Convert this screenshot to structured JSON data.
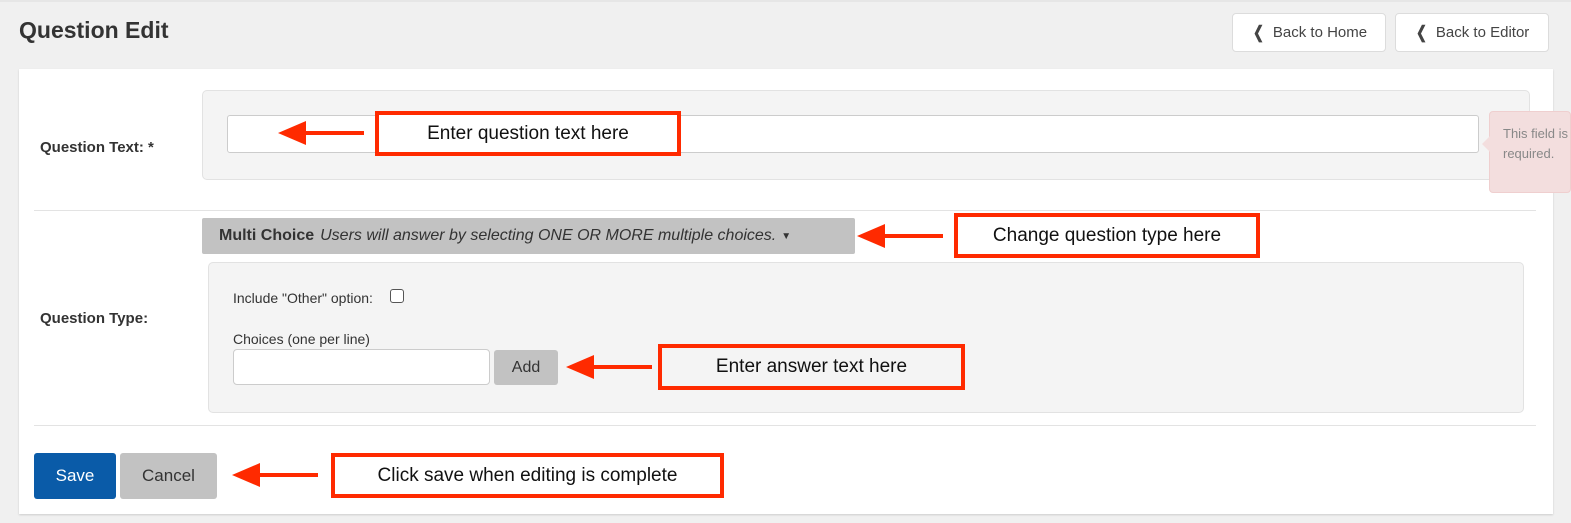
{
  "header": {
    "title": "Question Edit",
    "back_home_label": "Back to Home",
    "back_editor_label": "Back to Editor",
    "chevron_glyph": "❮"
  },
  "form": {
    "question_text_label": "Question Text: *",
    "question_text_value": "",
    "validation_message": "This field is required.",
    "question_type_label": "Question Type:",
    "question_type": {
      "selected_name": "Multi Choice",
      "selected_description": "Users will answer by selecting ONE OR MORE multiple choices.",
      "caret_glyph": "▼"
    },
    "include_other_label": "Include \"Other\" option:",
    "include_other_checked": false,
    "choices_label": "Choices (one per line)",
    "choices_value": "",
    "add_label": "Add",
    "save_label": "Save",
    "cancel_label": "Cancel"
  },
  "annotations": {
    "question_text": "Enter question text here",
    "question_type": "Change question type here",
    "answer_text": "Enter answer text here",
    "save": "Click save when editing is complete"
  },
  "colors": {
    "primary": "#0a5ba8",
    "annotation": "#ff2a00",
    "secondary_button": "#c2c2c2",
    "error_bg": "#f3dede"
  }
}
